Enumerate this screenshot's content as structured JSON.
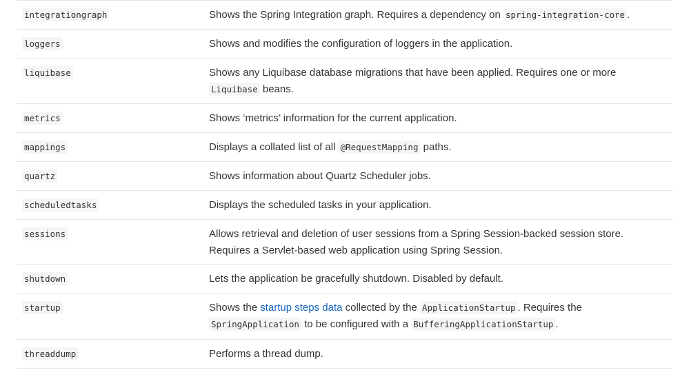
{
  "rows": [
    {
      "id": "integrationgraph",
      "desc_pre": "Shows the Spring Integration graph. Requires a dependency on ",
      "desc_code": "spring-integration-core",
      "desc_post": "."
    },
    {
      "id": "loggers",
      "desc": "Shows and modifies the configuration of loggers in the application."
    },
    {
      "id": "liquibase",
      "desc_pre": "Shows any Liquibase database migrations that have been applied. Requires one or more ",
      "desc_code": "Liquibase",
      "desc_post": " beans."
    },
    {
      "id": "metrics",
      "desc": "Shows ‘metrics’ information for the current application."
    },
    {
      "id": "mappings",
      "desc_pre": "Displays a collated list of all ",
      "desc_code": "@RequestMapping",
      "desc_post": " paths."
    },
    {
      "id": "quartz",
      "desc": "Shows information about Quartz Scheduler jobs."
    },
    {
      "id": "scheduledtasks",
      "desc": "Displays the scheduled tasks in your application."
    },
    {
      "id": "sessions",
      "desc": "Allows retrieval and deletion of user sessions from a Spring Session-backed session store. Requires a Servlet-based web application using Spring Session."
    },
    {
      "id": "shutdown",
      "desc": "Lets the application be gracefully shutdown. Disabled by default."
    },
    {
      "id": "startup",
      "desc_1": "Shows the ",
      "link": "startup steps data",
      "desc_2": " collected by the ",
      "code_1": "ApplicationStartup",
      "desc_3": ". Requires the ",
      "code_2": "SpringApplication",
      "desc_4": " to be configured with a ",
      "code_3": "BufferingApplicationStartup",
      "desc_5": "."
    },
    {
      "id": "threaddump",
      "desc": "Performs a thread dump."
    }
  ]
}
